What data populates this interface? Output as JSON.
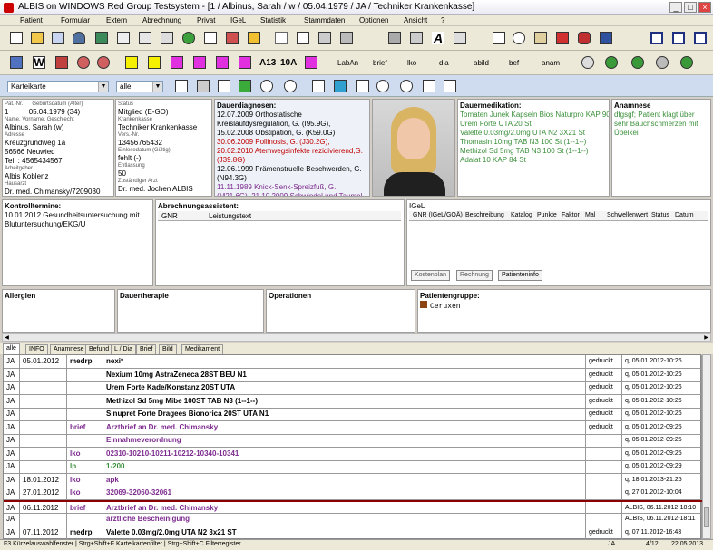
{
  "window": {
    "title": "ALBIS on WINDOWS Red Group Testsystem - [1 / Albinus, Sarah / w / 05.04.1979 / JA / Techniker Krankenkasse]",
    "min": "_",
    "max": "□",
    "close": "×"
  },
  "menu": [
    "Patient",
    "Formular",
    "Extern",
    "Abrechnung",
    "Privat",
    "IGeL",
    "Statistik",
    "Stammdaten",
    "Optionen",
    "Ansicht",
    "?"
  ],
  "toolbar2": {
    "icon_labels": [
      "A13",
      "10A"
    ],
    "text_buttons": [
      "LabAn",
      "brief",
      "lko",
      "dia",
      "abild",
      "bef",
      "anam"
    ]
  },
  "filter": {
    "view": "Karteikarte",
    "scope": "alle"
  },
  "patient": {
    "pat_nr_label": "Pat.-Nr.",
    "pat_nr": "1",
    "geb_label": "Geburtsdatum (Alter)",
    "geb": "05.04.1979 (34)",
    "name_label": "Name, Vorname, Geschlecht",
    "name": "Albinus, Sarah (w)",
    "adr_label": "Adresse",
    "street": "Kreuzgrundweg 1a",
    "city": "56566 Neuwied",
    "tel": "Tel. : 4565434567",
    "arb_label": "Arbeitgeber",
    "arbeitgeber": "Albis Koblenz",
    "haus_label": "Hausarzt",
    "hausarzt": "Dr. med. Chimansky/7209030"
  },
  "insurance": {
    "status_label": "Status",
    "status": "Mitglied (E-GO)",
    "kk_label": "Krankenkasse",
    "kk": "Techniker Krankenkasse",
    "vers_label": "Vers.-Nr.",
    "vers": "13456765432",
    "einl_label": "Einlesedatum (Gültig)",
    "einl": "fehlt (-)",
    "entl_label": "Entlassung",
    "entl": "50",
    "zust_label": "Zuständiger Arzt",
    "zust": "Dr. med. Jochen ALBIS"
  },
  "dauerdiagnosen": {
    "title": "Dauerdiagnosen:",
    "lines": [
      {
        "t": "12.07.2009 Orthostatische Kreislaufdysregulation, G. (I95.9G), 15.02.2008 Obstipation, G. (K59.0G)",
        "c": ""
      },
      {
        "t": "30.06.2009 Pollinosis, G. (J30.2G), 20.02.2010 Atemwegsinfekte rezidivierend,G. (J39.8G)",
        "c": "red"
      },
      {
        "t": "12.06.1999 Prämenstruelle Beschwerden, G. (N94.3G)",
        "c": ""
      },
      {
        "t": "11.11.1989 Knick-Senk-Spreizfuß, G. (M21.6G), 21.10.2009 Schwindel und Taumel, G. (R42G), 20.05.2011 Mumps-Parotitis (K87.1*), V.a.",
        "c": "pur"
      }
    ]
  },
  "dauermedikation": {
    "title": "Dauermedikation:",
    "lines": [
      "Tomaten Junek Kapseln Bios Naturpro KAP 90 St",
      "Urem Forte UTA 20 St",
      "Valette 0.03mg/2.0mg UTA N2 3X21 St",
      "Thomasin 10mg TAB N3 100 St (1--1--)",
      "Methizol Sd 5mg TAB N3 100 St (1--1--)",
      "Adalat 10 KAP 84 St"
    ]
  },
  "anamnese": {
    "title": "Anamnese",
    "text": "dfgsgf; Patient klagt über sehr Bauchschmerzen mit Übelkei"
  },
  "kontroll": {
    "title": "Kontrolltermine:",
    "text": "10.01.2012 Gesundheitsuntersuchung mit Blutuntersuchung/EKG/U"
  },
  "abrechnung": {
    "title": "Abrechnungsassistent:",
    "cols": [
      "GNR",
      "Leistungstext"
    ]
  },
  "igel": {
    "title": "IGeL",
    "cols": [
      "GNR (IGeL/GOÄ)",
      "Beschreibung",
      "Katalog",
      "Punkte",
      "Faktor",
      "Mal",
      "Schwellenwert",
      "Status",
      "Datum"
    ],
    "buttons": [
      "Kostenplan",
      "Rechnung",
      "Patienteninfo"
    ]
  },
  "lower": {
    "allergien": "Allergien",
    "dauertherapie": "Dauertherapie",
    "operationen": "Operationen",
    "patgruppe": "Patientengruppe:",
    "gruppe": "Ceruxen"
  },
  "tabs": [
    "alle",
    "INFO",
    "Anamnese",
    "Befund",
    "L / Dia",
    "Brief",
    "Bild",
    "Medikament"
  ],
  "rows": [
    {
      "u": "JA",
      "d": "05.01.2012",
      "k": "medrp",
      "kc": "",
      "e": "nexi*",
      "ec": "",
      "s": "gedruckt",
      "ts": "q, 05.01.2012-10:26"
    },
    {
      "u": "JA",
      "d": "",
      "k": "",
      "kc": "",
      "e": "Nexium 10mg AstraZeneca 28ST BEU N1",
      "ec": "b",
      "s": "gedruckt",
      "ts": "q, 05.01.2012-10:26"
    },
    {
      "u": "JA",
      "d": "",
      "k": "",
      "kc": "",
      "e": "Urem Forte Kade/Konstanz 20ST UTA",
      "ec": "b",
      "s": "gedruckt",
      "ts": "q, 05.01.2012-10:26"
    },
    {
      "u": "JA",
      "d": "",
      "k": "",
      "kc": "",
      "e": "Methizol Sd 5mg Mibe 100ST TAB N3 (1--1--)",
      "ec": "b",
      "s": "gedruckt",
      "ts": "q, 05.01.2012-10:26"
    },
    {
      "u": "JA",
      "d": "",
      "k": "",
      "kc": "",
      "e": "Sinupret Forte Dragees Bionorica 20ST UTA N1",
      "ec": "b",
      "s": "gedruckt",
      "ts": "q, 05.01.2012-10:26"
    },
    {
      "u": "JA",
      "d": "",
      "k": "brief",
      "kc": "pur",
      "e": "Arztbrief an Dr. med. Chimansky",
      "ec": "pur",
      "s": "gedruckt",
      "ts": "q, 05.01.2012-09:25"
    },
    {
      "u": "JA",
      "d": "",
      "k": "",
      "kc": "",
      "e": "Einnahmeverordnung",
      "ec": "pur",
      "s": "",
      "ts": "q, 05.01.2012-09:25"
    },
    {
      "u": "JA",
      "d": "",
      "k": "lko",
      "kc": "pur",
      "e": "02310-10210-10211-10212-10340-10341",
      "ec": "pur",
      "s": "",
      "ts": "q, 05.01.2012-09:25"
    },
    {
      "u": "JA",
      "d": "",
      "k": "lp",
      "kc": "grn",
      "e": "1-200",
      "ec": "grn",
      "s": "",
      "ts": "q, 05.01.2012-09:29"
    },
    {
      "u": "JA",
      "d": "18.01.2012",
      "k": "lko",
      "kc": "pur",
      "e": "apk",
      "ec": "pur",
      "s": "",
      "ts": "q, 18.01.2013-21:25"
    },
    {
      "u": "JA",
      "d": "27.01.2012",
      "k": "lko",
      "kc": "pur",
      "e": "32069-32060-32061",
      "ec": "pur",
      "s": "",
      "ts": "q, 27.01.2012-10:04"
    },
    {
      "u": "JA",
      "d": "06.11.2012",
      "k": "brief",
      "kc": "pur",
      "e": "Arztbrief an Dr. med. Chimansky",
      "ec": "pur",
      "s": "",
      "ts": "ALBIS, 06.11.2012-18:10"
    },
    {
      "u": "JA",
      "d": "",
      "k": "",
      "kc": "",
      "e": "arztliche Bescheinigung",
      "ec": "pur",
      "s": "",
      "ts": "ALBIS, 06.11.2012-18:11"
    },
    {
      "u": "JA",
      "d": "07.11.2012",
      "k": "medrp",
      "kc": "",
      "e": "Valette 0.03mg/2.0mg UTA N2 3x21 ST",
      "ec": "b",
      "s": "gedruckt",
      "ts": "q, 07.11.2012-16:43"
    }
  ],
  "status": {
    "hint": "F3 Kürzelauswahlfenster | Strg+Shift+F Karteikartenfilter | Strg+Shift+C Filterregister",
    "user": "JA",
    "page": "4/12",
    "date": "22.05.2013"
  },
  "colors": {
    "purple": "#7c2a8e",
    "green": "#3a8f3a",
    "red": "#c00000",
    "divider": "#8b0000"
  }
}
